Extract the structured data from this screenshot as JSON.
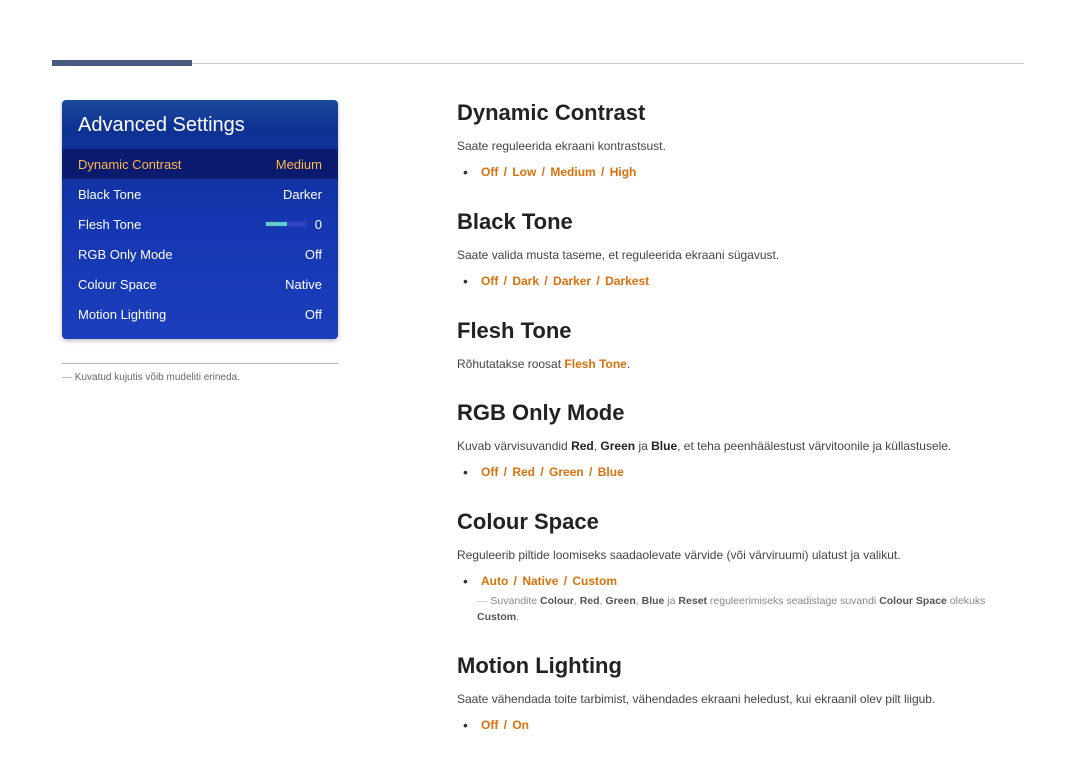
{
  "menu": {
    "title": "Advanced Settings",
    "items": [
      {
        "label": "Dynamic Contrast",
        "value": "Medium",
        "selected": true
      },
      {
        "label": "Black Tone",
        "value": "Darker"
      },
      {
        "label": "Flesh Tone",
        "value": "0",
        "slider": true
      },
      {
        "label": "RGB Only Mode",
        "value": "Off"
      },
      {
        "label": "Colour Space",
        "value": "Native"
      },
      {
        "label": "Motion Lighting",
        "value": "Off"
      }
    ]
  },
  "footnote": "Kuvatud kujutis võib mudeliti erineda.",
  "sections": {
    "dynamicContrast": {
      "title": "Dynamic Contrast",
      "desc": "Saate reguleerida ekraani kontrastsust.",
      "options": [
        "Off",
        "Low",
        "Medium",
        "High"
      ]
    },
    "blackTone": {
      "title": "Black Tone",
      "desc": "Saate valida musta taseme, et reguleerida ekraani sügavust.",
      "options": [
        "Off",
        "Dark",
        "Darker",
        "Darkest"
      ]
    },
    "fleshTone": {
      "title": "Flesh Tone",
      "descPrefix": "Rõhutatakse roosat ",
      "descHighlight": "Flesh Tone",
      "descSuffix": "."
    },
    "rgbOnly": {
      "title": "RGB Only Mode",
      "desc1": "Kuvab värvisuvandid ",
      "red": "Red",
      "comma": ", ",
      "green": "Green",
      "ja": " ja ",
      "blue": "Blue",
      "desc2": ", et teha peenhäälestust värvitoonile ja küllastusele.",
      "options": [
        "Off",
        "Red",
        "Green",
        "Blue"
      ]
    },
    "colourSpace": {
      "title": "Colour Space",
      "desc": "Reguleerib piltide loomiseks saadaolevate värvide (või värviruumi) ulatust ja valikut.",
      "options": [
        "Auto",
        "Native",
        "Custom"
      ],
      "sub1": "Suvandite ",
      "colour": "Colour",
      "red": "Red",
      "green": "Green",
      "blue": "Blue",
      "reset": "Reset",
      "sub2": " reguleerimiseks seadistage suvandi ",
      "cs": "Colour Space",
      "sub3": " olekuks ",
      "custom": "Custom",
      "sub4": "."
    },
    "motionLighting": {
      "title": "Motion Lighting",
      "desc": "Saate vähendada toite tarbimist, vähendades ekraani heledust, kui ekraanil olev pilt liigub.",
      "options": [
        "Off",
        "On"
      ]
    }
  }
}
